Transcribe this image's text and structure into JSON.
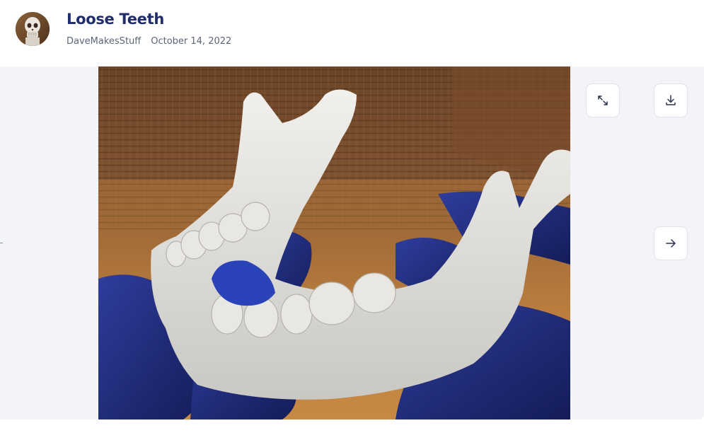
{
  "post": {
    "title": "Loose Teeth",
    "author": "DaveMakesStuff",
    "date": "October 14, 2022"
  },
  "viewer": {
    "buttons": {
      "expand_icon": "expand-icon",
      "download_icon": "download-icon",
      "next_icon": "arrow-right-icon"
    }
  },
  "colors": {
    "title": "#1f2d6b",
    "meta": "#5b6478",
    "viewer_bg": "#f3f4f8"
  }
}
